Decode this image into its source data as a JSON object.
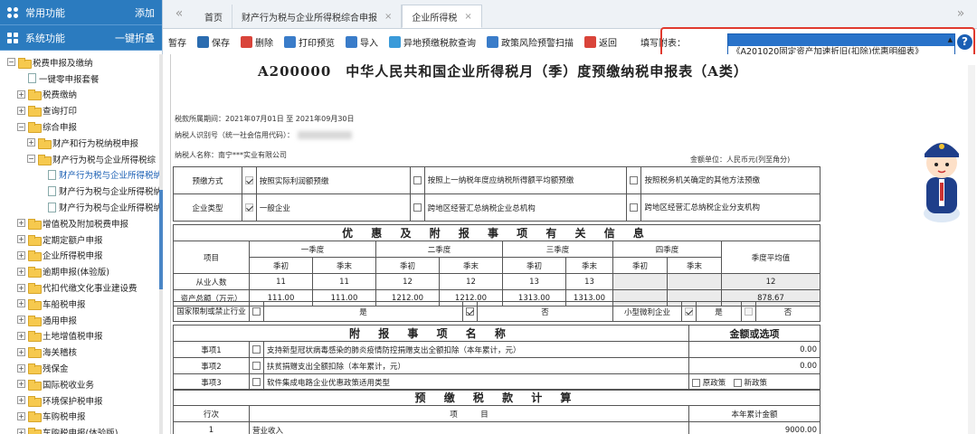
{
  "sidebar": {
    "top_label": "常用功能",
    "top_action": "添加",
    "sys_label": "系统功能",
    "sys_action": "一键折叠",
    "tree": [
      {
        "label": "税费申报及缴纳",
        "depth": 0,
        "toggle": "−",
        "kind": "fold"
      },
      {
        "label": "一键零申报套餐",
        "depth": 1,
        "toggle": "",
        "kind": "doc"
      },
      {
        "label": "税费缴纳",
        "depth": 1,
        "toggle": "+",
        "kind": "fold"
      },
      {
        "label": "查询打印",
        "depth": 1,
        "toggle": "+",
        "kind": "fold"
      },
      {
        "label": "综合申报",
        "depth": 1,
        "toggle": "−",
        "kind": "fold"
      },
      {
        "label": "财产和行为税纳税申报",
        "depth": 2,
        "toggle": "+",
        "kind": "fold"
      },
      {
        "label": "财产行为税与企业所得税综",
        "depth": 2,
        "toggle": "−",
        "kind": "fold"
      },
      {
        "label": "财产行为税与企业所得税纳",
        "depth": 3,
        "toggle": "",
        "kind": "doc",
        "selected": true
      },
      {
        "label": "财产行为税与企业所得税纳",
        "depth": 3,
        "toggle": "",
        "kind": "doc"
      },
      {
        "label": "财产行为税与企业所得税纳",
        "depth": 3,
        "toggle": "",
        "kind": "doc"
      },
      {
        "label": "增值税及附加税费申报",
        "depth": 1,
        "toggle": "+",
        "kind": "fold"
      },
      {
        "label": "定期定额户申报",
        "depth": 1,
        "toggle": "+",
        "kind": "fold"
      },
      {
        "label": "企业所得税申报",
        "depth": 1,
        "toggle": "+",
        "kind": "fold"
      },
      {
        "label": "逾期申报(体验版)",
        "depth": 1,
        "toggle": "+",
        "kind": "fold"
      },
      {
        "label": "代扣代缴文化事业建设费",
        "depth": 1,
        "toggle": "+",
        "kind": "fold"
      },
      {
        "label": "车船税申报",
        "depth": 1,
        "toggle": "+",
        "kind": "fold"
      },
      {
        "label": "通用申报",
        "depth": 1,
        "toggle": "+",
        "kind": "fold"
      },
      {
        "label": "土地增值税申报",
        "depth": 1,
        "toggle": "+",
        "kind": "fold"
      },
      {
        "label": "海关稽核",
        "depth": 1,
        "toggle": "+",
        "kind": "fold"
      },
      {
        "label": "残保金",
        "depth": 1,
        "toggle": "+",
        "kind": "fold"
      },
      {
        "label": "国际税收业务",
        "depth": 1,
        "toggle": "+",
        "kind": "fold"
      },
      {
        "label": "环境保护税申报",
        "depth": 1,
        "toggle": "+",
        "kind": "fold"
      },
      {
        "label": "车购税申报",
        "depth": 1,
        "toggle": "+",
        "kind": "fold"
      },
      {
        "label": "车购税申报(体验版)",
        "depth": 1,
        "toggle": "+",
        "kind": "fold"
      }
    ]
  },
  "tabs": {
    "nav_left": "«",
    "nav_right": "»",
    "items": [
      {
        "label": "首页"
      },
      {
        "label": "财产行为税与企业所得税综合申报",
        "close": "×"
      },
      {
        "label": "企业所得税",
        "close": "×",
        "active": true
      }
    ]
  },
  "toolbar": {
    "items": [
      {
        "label": "暂存",
        "color": "#ffffff"
      },
      {
        "label": "保存",
        "color": "#2b6cb0"
      },
      {
        "label": "删除",
        "color": "#d9443a"
      },
      {
        "label": "打印预览",
        "color": "#3a7cc9"
      },
      {
        "label": "导入",
        "color": "#3a7cc9"
      },
      {
        "label": "异地预缴税款查询",
        "color": "#3a9ad9"
      },
      {
        "label": "政策风险预警扫描",
        "color": "#3a7cc9"
      },
      {
        "label": "返回",
        "color": "#d9443a"
      }
    ],
    "fill_label": "填写附表：",
    "help": "?"
  },
  "attachment": {
    "selected": "",
    "option": "《A201020固定资产加速折旧(扣除)优惠明细表》",
    "arrow": "▲"
  },
  "form": {
    "title": "A200000　中华人民共和国企业所得税月（季）度预缴纳税申报表（A类）",
    "period": "税款所属期间：2021年07月01日 至 2021年09月30日",
    "taxid": "纳税人识别号（统一社会信用代码）：",
    "name": "纳税人名称：南宁***实业有限公司",
    "unit": "金额单位：人民币元(列至角分)",
    "prepay_label": "预缴方式",
    "prepay_opts": [
      "按照实际利润额预缴",
      "按照上一纳税年度应纳税所得额平均额预缴",
      "按照税务机关确定的其他方法预缴"
    ],
    "type_label": "企业类型",
    "type_opts": [
      "一般企业",
      "跨地区经营汇总纳税企业总机构",
      "跨地区经营汇总纳税企业分支机构"
    ],
    "sec1": "优 惠 及 附 报 事 项 有 关 信 息",
    "item_label": "项目",
    "quarters": [
      "一季度",
      "二季度",
      "三季度",
      "四季度"
    ],
    "qavg": "季度平均值",
    "sub": [
      "季初",
      "季末",
      "季初",
      "季末",
      "季初",
      "季末",
      "季初",
      "季末"
    ],
    "emp_label": "从业人数",
    "emp": [
      "11",
      "11",
      "12",
      "12",
      "13",
      "13",
      "",
      "",
      "12"
    ],
    "asset_label": "资产总额（万元）",
    "asset": [
      "111.00",
      "111.00",
      "1212.00",
      "1212.00",
      "1313.00",
      "1313.00",
      "",
      "",
      "878.67"
    ],
    "restrict_label": "国家限制或禁止行业",
    "yes": "是",
    "no": "否",
    "small_label": "小型微利企业",
    "sec2": "附 报 事 项 名 称",
    "amt_label": "金额或选项",
    "matters": [
      {
        "label": "事项1",
        "text": "支持新型冠状病毒感染的肺炎疫情防控捐赠支出全额扣除（本年累计，元）",
        "val": "0.00"
      },
      {
        "label": "事项2",
        "text": "扶贫捐赠支出全额扣除（本年累计，元）",
        "val": "0.00"
      },
      {
        "label": "事项3",
        "text": "软件集成电路企业优惠政策适用类型",
        "opt1": "原政策",
        "opt2": "新政策"
      }
    ],
    "sec3": "预 缴 税 款 计 算",
    "row_hdr": "行次",
    "proj_hdr": "项　　　目",
    "cum_hdr": "本年累计金额",
    "rows": [
      {
        "no": "1",
        "label": "营业收入",
        "val": "9000.00"
      }
    ]
  }
}
